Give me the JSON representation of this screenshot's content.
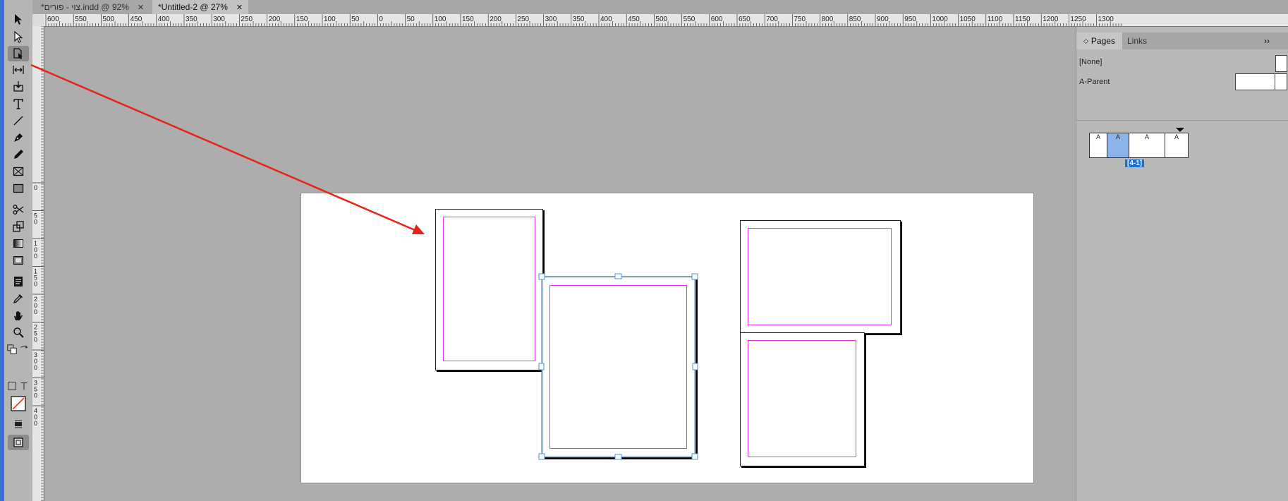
{
  "tabs": [
    {
      "label": "*צוי - פורים.indd @ 92%",
      "close": "✕"
    },
    {
      "label": "*Untitled-2 @ 27%",
      "close": "✕"
    }
  ],
  "ruler_top": [
    "600",
    "550",
    "500",
    "450",
    "400",
    "350",
    "300",
    "250",
    "200",
    "150",
    "100",
    "50",
    "0",
    "50",
    "100",
    "150",
    "200",
    "250",
    "300",
    "350",
    "400",
    "450",
    "500",
    "550",
    "600",
    "650",
    "700",
    "750",
    "800",
    "850",
    "900",
    "950",
    "1000",
    "1050",
    "1100",
    "1150",
    "1200",
    "1250",
    "1300"
  ],
  "ruler_left": [
    "0",
    "5 0",
    "1 0 0",
    "1 5 0",
    "2 0 0",
    "2 5 0",
    "3 0 0",
    "3 5 0",
    "4 0 0"
  ],
  "tools": [
    "selection-tool",
    "direct-selection-tool",
    "page-tool",
    "gap-tool",
    "content-collector-tool",
    "type-tool",
    "line-tool",
    "pen-tool",
    "pencil-tool",
    "rectangle-frame-tool",
    "rectangle-tool",
    "scissors-tool",
    "free-transform-tool",
    "gradient-swatch-tool",
    "gradient-feather-tool",
    "note-tool",
    "eyedropper-tool",
    "hand-tool",
    "zoom-tool"
  ],
  "panel": {
    "tabs": [
      "Pages",
      "Links"
    ],
    "collapse": "››",
    "parents": [
      {
        "label": "[None]"
      },
      {
        "label": "A-Parent"
      }
    ],
    "spread_letters": [
      "A",
      "A",
      "A",
      "A"
    ],
    "spread_label": "[4-1]"
  },
  "colors": {
    "margin": "#e23ae2",
    "selection": "#4a90e2",
    "annotation_arrow": "#e8231a"
  }
}
